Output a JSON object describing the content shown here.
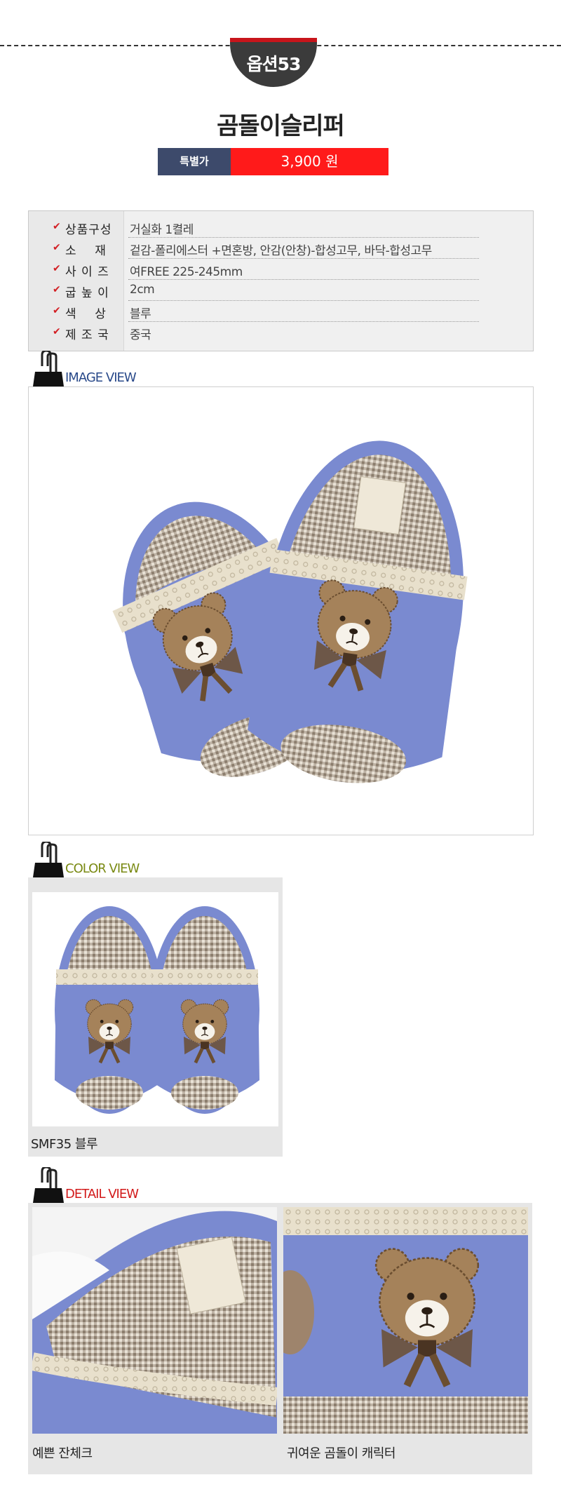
{
  "header": {
    "option_badge": "옵션53",
    "product_title": "곰돌이슬리퍼"
  },
  "price": {
    "label": "특별가",
    "value": "3,900 원"
  },
  "specs": [
    {
      "label": "상품구성",
      "value": "거실화 1켤레"
    },
    {
      "label": "소    재",
      "value": "겉감-폴리에스터 +면혼방, 안감(안창)-합성고무, 바닥-합성고무"
    },
    {
      "label": "사 이 즈",
      "value": "여FREE 225-245mm"
    },
    {
      "label": "굽 높 이",
      "value": "2cm"
    },
    {
      "label": "색    상",
      "value": "블루"
    },
    {
      "label": "제 조 국",
      "value": "중국"
    }
  ],
  "sections": {
    "image_view": "IMAGE VIEW",
    "color_view": "COLOR VIEW",
    "detail_view": "DETAIL VIEW"
  },
  "color_caption": "SMF35 블루",
  "detail_captions": [
    "예쁜 잔체크",
    "귀여운 곰돌이 캐릭터"
  ],
  "colors": {
    "price_label_bg": "#3d4a6b",
    "price_value_bg": "#ff1a1a",
    "check": "#d31f24",
    "image_view_title": "#2a4a8a",
    "color_view_title": "#7a8a14",
    "detail_view_title": "#d21a1a",
    "slipper_blue": "#7a8ad0"
  }
}
